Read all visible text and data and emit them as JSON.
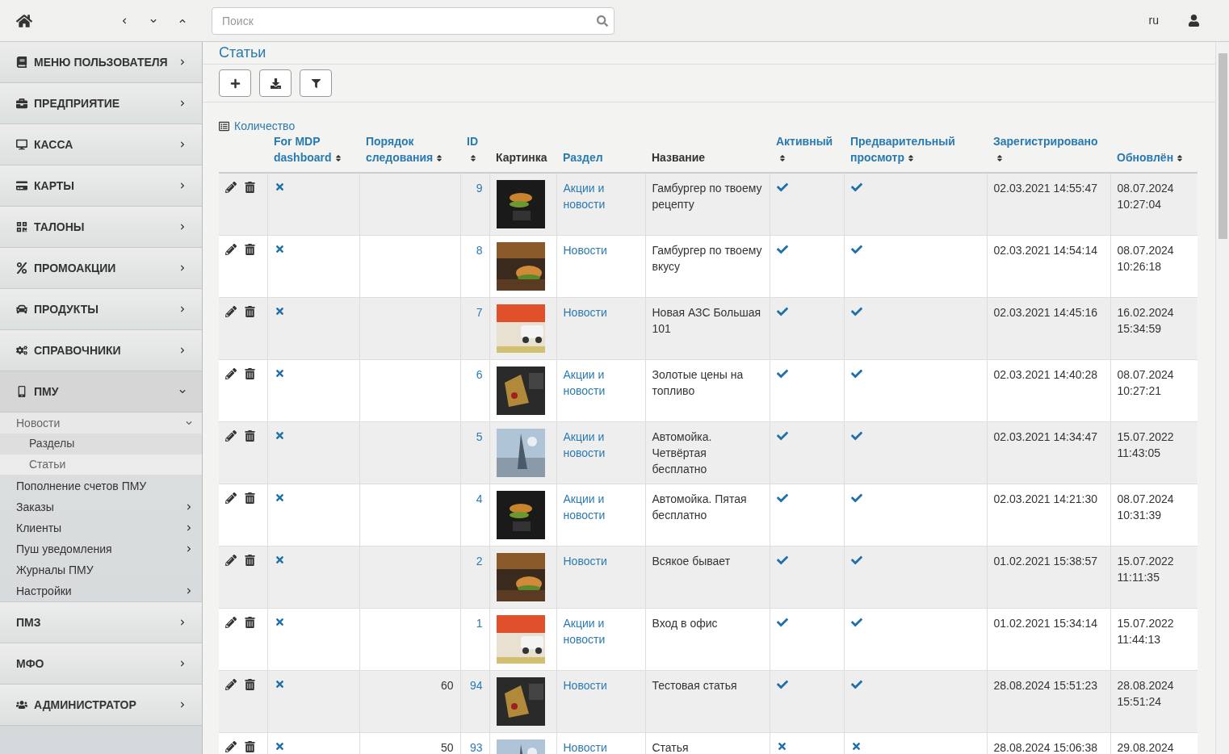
{
  "topbar": {
    "search": {
      "placeholder": "Поиск"
    },
    "language": "ru"
  },
  "sidebar": [
    {
      "label": "МЕНЮ ПОЛЬЗОВАТЕЛЯ",
      "expanded": false
    },
    {
      "label": "ПРЕДПРИЯТИЕ",
      "expanded": false
    },
    {
      "label": "КАССА",
      "expanded": false
    },
    {
      "label": "КАРТЫ",
      "expanded": false
    },
    {
      "label": "ТАЛОНЫ",
      "expanded": false
    },
    {
      "label": "ПРОМОАКЦИИ",
      "expanded": false
    },
    {
      "label": "ПРОДУКТЫ",
      "expanded": false
    },
    {
      "label": "СПРАВОЧНИКИ",
      "expanded": false
    },
    {
      "label": "ПМУ",
      "expanded": true,
      "children": [
        {
          "label": "Новости",
          "expanded": true,
          "children": [
            {
              "label": "Разделы",
              "selected": true
            },
            {
              "label": "Статьи",
              "selected": false
            }
          ]
        },
        {
          "label": "Пополнение счетов ПМУ",
          "has_submenu": false
        },
        {
          "label": "Заказы",
          "has_submenu": true
        },
        {
          "label": "Клиенты",
          "has_submenu": true
        },
        {
          "label": "Пуш уведомления",
          "has_submenu": true
        },
        {
          "label": "Журналы ПМУ",
          "has_submenu": false
        },
        {
          "label": "Настройки",
          "has_submenu": true
        }
      ]
    },
    {
      "label": "ПМЗ",
      "expanded": false
    },
    {
      "label": "МФО",
      "expanded": false
    },
    {
      "label": "АДМИНИСТРАТОР",
      "expanded": false
    }
  ],
  "page_title": "Статьи",
  "count_link": "Количество",
  "table": {
    "columns": [
      {
        "label": "For MDP dashboard",
        "sortable": true,
        "link": true
      },
      {
        "label": "Порядок следования",
        "sortable": true,
        "link": true
      },
      {
        "label": "ID",
        "sortable": true,
        "link": true
      },
      {
        "label": "Картинка",
        "sortable": false,
        "link": false
      },
      {
        "label": "Раздел",
        "sortable": false,
        "link": true
      },
      {
        "label": "Название",
        "sortable": false,
        "link": false
      },
      {
        "label": "Активный",
        "sortable": true,
        "link": true
      },
      {
        "label": "Предварительный просмотр",
        "sortable": true,
        "link": true
      },
      {
        "label": "Зарегистрировано",
        "sortable": true,
        "link": true
      },
      {
        "label": "Обновлён",
        "sortable": true,
        "link": true
      }
    ],
    "rows": [
      {
        "for_mdp": false,
        "order": "",
        "id": "9",
        "section": "Акции и новости",
        "title": "Гамбургер по твоему рецепту",
        "active": true,
        "preview": true,
        "registered": "02.03.2021 14:55:47",
        "updated": "08.07.2024 10:27:04"
      },
      {
        "for_mdp": false,
        "order": "",
        "id": "8",
        "section": "Новости",
        "title": "Гамбургер по твоему вкусу",
        "active": true,
        "preview": true,
        "registered": "02.03.2021 14:54:14",
        "updated": "08.07.2024 10:26:18"
      },
      {
        "for_mdp": false,
        "order": "",
        "id": "7",
        "section": "Новости",
        "title": "Новая АЗС Большая 101",
        "active": true,
        "preview": true,
        "registered": "02.03.2021 14:45:16",
        "updated": "16.02.2024 15:34:59"
      },
      {
        "for_mdp": false,
        "order": "",
        "id": "6",
        "section": "Акции и новости",
        "title": "Золотые цены на топливо",
        "active": true,
        "preview": true,
        "registered": "02.03.2021 14:40:28",
        "updated": "08.07.2024 10:27:21"
      },
      {
        "for_mdp": false,
        "order": "",
        "id": "5",
        "section": "Акции и новости",
        "title": "Автомойка. Четвёртая бесплатно",
        "active": true,
        "preview": true,
        "registered": "02.03.2021 14:34:47",
        "updated": "15.07.2022 11:43:05"
      },
      {
        "for_mdp": false,
        "order": "",
        "id": "4",
        "section": "Акции и новости",
        "title": "Автомойка. Пятая бесплатно",
        "active": true,
        "preview": true,
        "registered": "02.03.2021 14:21:30",
        "updated": "08.07.2024 10:31:39"
      },
      {
        "for_mdp": false,
        "order": "",
        "id": "2",
        "section": "Новости",
        "title": "Всякое бывает",
        "active": true,
        "preview": true,
        "registered": "01.02.2021 15:38:57",
        "updated": "15.07.2022 11:11:35"
      },
      {
        "for_mdp": false,
        "order": "",
        "id": "1",
        "section": "Акции и новости",
        "title": "Вход в офис",
        "active": true,
        "preview": true,
        "registered": "01.02.2021 15:34:14",
        "updated": "15.07.2022 11:44:13"
      },
      {
        "for_mdp": false,
        "order": "60",
        "id": "94",
        "section": "Новости",
        "title": "Тестовая статья",
        "active": true,
        "preview": true,
        "registered": "28.08.2024 15:51:23",
        "updated": "28.08.2024 15:51:24"
      },
      {
        "for_mdp": false,
        "order": "50",
        "id": "93",
        "section": "Новости",
        "title": "Статья",
        "active": false,
        "preview": false,
        "registered": "28.08.2024 15:06:38",
        "updated": "29.08.2024"
      }
    ]
  }
}
